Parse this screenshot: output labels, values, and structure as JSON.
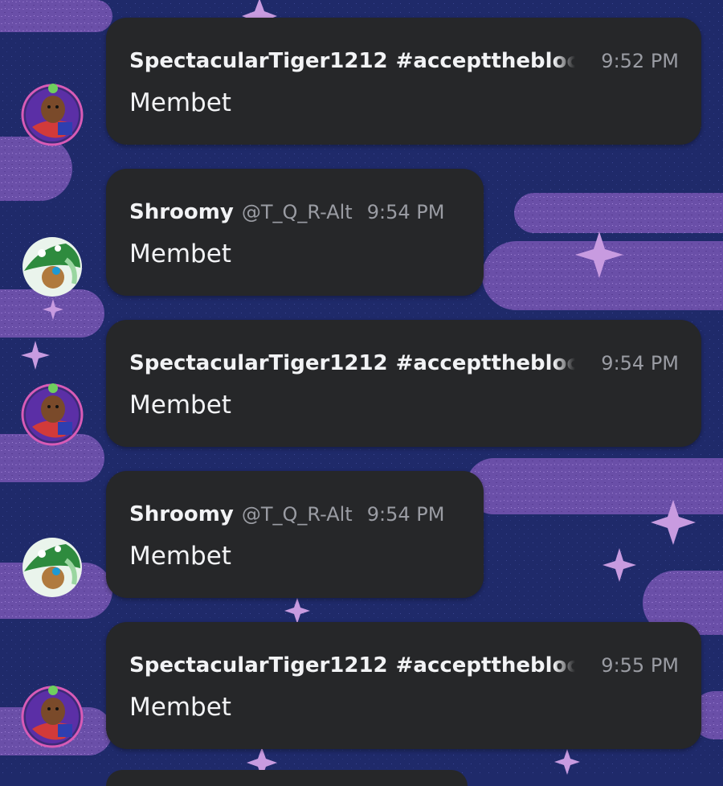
{
  "messages": [
    {
      "author": "SpectacularTiger1212",
      "tag": "#accepttheblock",
      "handle": "",
      "time": "9:52 PM",
      "text": "Membet",
      "avatar": "tiger-avatar"
    },
    {
      "author": "Shroomy",
      "tag": "",
      "handle": "@T_Q_R-Alt",
      "time": "9:54 PM",
      "text": "Membet",
      "avatar": "shroomy-avatar"
    },
    {
      "author": "SpectacularTiger1212",
      "tag": "#accepttheblock",
      "handle": "",
      "time": "9:54 PM",
      "text": "Membet",
      "avatar": "tiger-avatar"
    },
    {
      "author": "Shroomy",
      "tag": "",
      "handle": "@T_Q_R-Alt",
      "time": "9:54 PM",
      "text": "Membet",
      "avatar": "shroomy-avatar"
    },
    {
      "author": "SpectacularTiger1212",
      "tag": "#accepttheblock",
      "handle": "",
      "time": "9:55 PM",
      "text": "Membet",
      "avatar": "tiger-avatar"
    }
  ],
  "colors": {
    "background": "#1f2a6a",
    "cloud": "#6a4fa8",
    "star": "#c89be0",
    "bubble": "#262729",
    "name_text": "#f2f3f5",
    "meta_text": "#9a9ca3"
  }
}
